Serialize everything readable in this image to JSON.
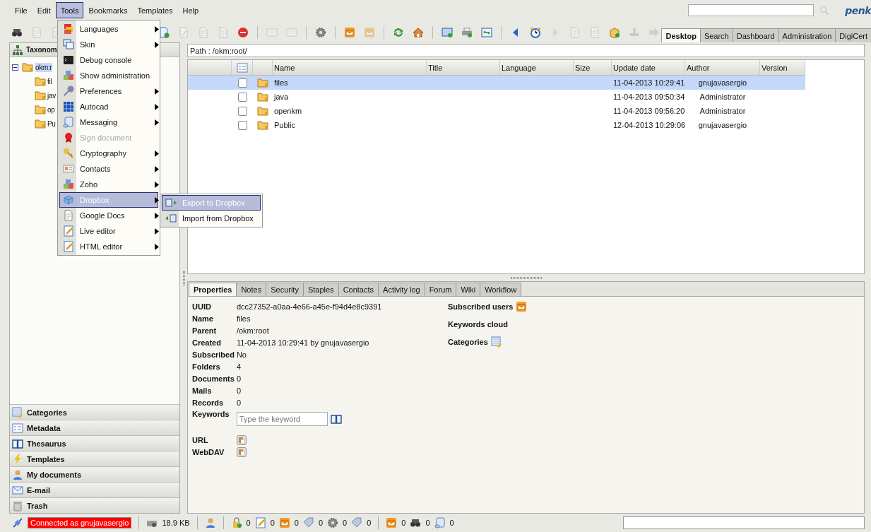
{
  "menu_bar": {
    "items": [
      {
        "label": "File",
        "selected": false
      },
      {
        "label": "Edit",
        "selected": false
      },
      {
        "label": "Tools",
        "selected": true
      },
      {
        "label": "Bookmarks",
        "selected": false
      },
      {
        "label": "Templates",
        "selected": false
      },
      {
        "label": "Help",
        "selected": false
      }
    ],
    "logo": "penk"
  },
  "toolbar": {
    "buttons": [
      {
        "kind": "binoculars",
        "disabled": false
      },
      {
        "kind": "doc",
        "disabled": true
      },
      {
        "kind": "doc",
        "disabled": true
      },
      {
        "kind": "doc-add",
        "disabled": false
      },
      {
        "kind": "edit",
        "disabled": true
      },
      {
        "kind": "doc",
        "disabled": true
      },
      {
        "kind": "doc",
        "disabled": true
      },
      {
        "kind": "delete",
        "disabled": false
      },
      {
        "kind": "list",
        "disabled": true
      },
      {
        "kind": "list",
        "disabled": true
      },
      {
        "kind": "gear",
        "disabled": false
      },
      {
        "kind": "mail",
        "disabled": false
      },
      {
        "kind": "mail",
        "disabled": true
      },
      {
        "kind": "refresh",
        "disabled": false
      },
      {
        "kind": "home",
        "disabled": false
      },
      {
        "kind": "screen",
        "disabled": false
      },
      {
        "kind": "printer",
        "disabled": false
      },
      {
        "kind": "swap",
        "disabled": false
      },
      {
        "kind": "back",
        "disabled": false
      },
      {
        "kind": "clock",
        "disabled": false
      },
      {
        "kind": "forward",
        "disabled": true
      },
      {
        "kind": "doc",
        "disabled": true
      },
      {
        "kind": "doc",
        "disabled": true
      },
      {
        "kind": "package",
        "disabled": false
      },
      {
        "kind": "stamp",
        "disabled": true
      },
      {
        "kind": "arrow",
        "disabled": true
      }
    ],
    "tabs": [
      {
        "label": "Desktop",
        "selected": true
      },
      {
        "label": "Search",
        "selected": false
      },
      {
        "label": "Dashboard",
        "selected": false
      },
      {
        "label": "Administration",
        "selected": false
      },
      {
        "label": "DigiCert",
        "selected": false
      }
    ]
  },
  "tools_menu": {
    "items": [
      {
        "label": "Languages",
        "kind": "flags",
        "submenu": true,
        "disabled": false,
        "selected": false
      },
      {
        "label": "Skin",
        "kind": "windows",
        "submenu": true,
        "disabled": false,
        "selected": false
      },
      {
        "label": "Debug console",
        "kind": "console",
        "submenu": false,
        "disabled": false,
        "selected": false
      },
      {
        "label": "Show administration",
        "kind": "cubes",
        "submenu": false,
        "disabled": false,
        "selected": false
      },
      {
        "label": "Preferences",
        "kind": "wrench",
        "submenu": true,
        "disabled": false,
        "selected": false
      },
      {
        "label": "Autocad",
        "kind": "grid",
        "submenu": true,
        "disabled": false,
        "selected": false
      },
      {
        "label": "Messaging",
        "kind": "scroll",
        "submenu": true,
        "disabled": false,
        "selected": false
      },
      {
        "label": "Sign document",
        "kind": "ribbon",
        "submenu": false,
        "disabled": true,
        "selected": false
      },
      {
        "label": "Cryptography",
        "kind": "key",
        "submenu": true,
        "disabled": false,
        "selected": false
      },
      {
        "label": "Contacts",
        "kind": "card",
        "submenu": true,
        "disabled": false,
        "selected": false
      },
      {
        "label": "Zoho",
        "kind": "cubes",
        "submenu": true,
        "disabled": false,
        "selected": false
      },
      {
        "label": "Dropbox",
        "kind": "box",
        "submenu": true,
        "disabled": false,
        "selected": true
      },
      {
        "label": "Google Docs",
        "kind": "doc",
        "submenu": true,
        "disabled": false,
        "selected": false
      },
      {
        "label": "Live editor",
        "kind": "pencil",
        "submenu": true,
        "disabled": false,
        "selected": false
      },
      {
        "label": "HTML editor",
        "kind": "pencil",
        "submenu": true,
        "disabled": false,
        "selected": false
      }
    ]
  },
  "dropbox_submenu": {
    "items": [
      {
        "label": "Export to Dropbox",
        "kind": "export",
        "selected": true
      },
      {
        "label": "Import from Dropbox",
        "kind": "import",
        "selected": false
      }
    ]
  },
  "left_panel": {
    "title": "Taxonom",
    "tree": [
      {
        "label": "okm:r",
        "expanded": true,
        "selected": true,
        "children": [
          {
            "label": "fil",
            "selected": false
          },
          {
            "label": "jav",
            "selected": false
          },
          {
            "label": "op",
            "selected": false
          },
          {
            "label": "Pu",
            "selected": false
          }
        ]
      }
    ],
    "sections": [
      {
        "label": "Categories",
        "kind": "categories"
      },
      {
        "label": "Metadata",
        "kind": "metadata"
      },
      {
        "label": "Thesaurus",
        "kind": "book"
      },
      {
        "label": "Templates",
        "kind": "bolt"
      },
      {
        "label": "My documents",
        "kind": "person"
      },
      {
        "label": "E-mail",
        "kind": "envelope"
      },
      {
        "label": "Trash",
        "kind": "trash"
      }
    ]
  },
  "path": "Path : /okm:root/",
  "table": {
    "columns": [
      "Name",
      "Title",
      "Language",
      "Size",
      "Update date",
      "Author",
      "Version"
    ],
    "rows": [
      {
        "name": "files",
        "update_date": "11-04-2013 10:29:41",
        "author": "gnujavasergio",
        "selected": true,
        "checked": false
      },
      {
        "name": "java",
        "update_date": "11-04-2013 09:50:34",
        "author": "Administrator",
        "selected": false,
        "checked": false
      },
      {
        "name": "openkm",
        "update_date": "11-04-2013 09:56:20",
        "author": "Administrator",
        "selected": false,
        "checked": false
      },
      {
        "name": "Public",
        "update_date": "12-04-2013 10:29:06",
        "author": "gnujavasergio",
        "selected": false,
        "checked": false
      }
    ]
  },
  "properties": {
    "tabs": [
      {
        "label": "Properties",
        "selected": true
      },
      {
        "label": "Notes",
        "selected": false
      },
      {
        "label": "Security",
        "selected": false
      },
      {
        "label": "Staples",
        "selected": false
      },
      {
        "label": "Contacts",
        "selected": false
      },
      {
        "label": "Activity log",
        "selected": false
      },
      {
        "label": "Forum",
        "selected": false
      },
      {
        "label": "Wiki",
        "selected": false
      },
      {
        "label": "Workflow",
        "selected": false
      }
    ],
    "fields": [
      {
        "label": "UUID",
        "value": "dcc27352-a0aa-4e66-a45e-f94d4e8c9391"
      },
      {
        "label": "Name",
        "value": "files"
      },
      {
        "label": "Parent",
        "value": "/okm:root"
      },
      {
        "label": "Created",
        "value": "11-04-2013 10:29:41 by gnujavasergio"
      },
      {
        "label": "Subscribed",
        "value": "No"
      },
      {
        "label": "Folders",
        "value": "4"
      },
      {
        "label": "Documents",
        "value": "0"
      },
      {
        "label": "Mails",
        "value": "0"
      },
      {
        "label": "Records",
        "value": "0"
      }
    ],
    "keywords": {
      "label": "Keywords",
      "placeholder": "Type the keyword"
    },
    "links": [
      {
        "label": "URL"
      },
      {
        "label": "WebDAV"
      }
    ],
    "side": [
      {
        "label": "Subscribed users",
        "kind": "mail"
      },
      {
        "label": "Keywords cloud",
        "kind": "none"
      },
      {
        "label": "Categories",
        "kind": "categories"
      }
    ]
  },
  "status_bar": {
    "connection": "Connected as gnujavasergio",
    "size": "18.9 KB",
    "counters": [
      {
        "kind": "lock",
        "count": "0"
      },
      {
        "kind": "pencil",
        "count": "0"
      },
      {
        "kind": "mail",
        "count": "0"
      },
      {
        "kind": "tag",
        "count": "0"
      },
      {
        "kind": "gear",
        "count": "0"
      },
      {
        "kind": "tag",
        "count": "0"
      }
    ],
    "queue": [
      {
        "kind": "mail",
        "count": "0"
      },
      {
        "kind": "binoculars",
        "count": "0"
      },
      {
        "kind": "scroll",
        "count": "0"
      }
    ]
  }
}
